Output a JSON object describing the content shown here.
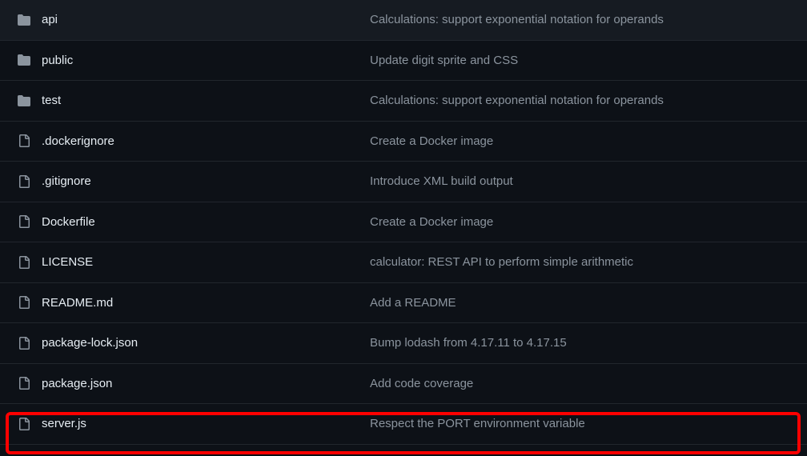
{
  "files": [
    {
      "type": "folder",
      "name": "api",
      "message": "Calculations: support exponential notation for operands"
    },
    {
      "type": "folder",
      "name": "public",
      "message": "Update digit sprite and CSS"
    },
    {
      "type": "folder",
      "name": "test",
      "message": "Calculations: support exponential notation for operands"
    },
    {
      "type": "file",
      "name": ".dockerignore",
      "message": "Create a Docker image"
    },
    {
      "type": "file",
      "name": ".gitignore",
      "message": "Introduce XML build output"
    },
    {
      "type": "file",
      "name": "Dockerfile",
      "message": "Create a Docker image"
    },
    {
      "type": "file",
      "name": "LICENSE",
      "message": "calculator: REST API to perform simple arithmetic"
    },
    {
      "type": "file",
      "name": "README.md",
      "message": "Add a README"
    },
    {
      "type": "file",
      "name": "package-lock.json",
      "message": "Bump lodash from 4.17.11 to 4.17.15"
    },
    {
      "type": "file",
      "name": "package.json",
      "message": "Add code coverage"
    },
    {
      "type": "file",
      "name": "server.js",
      "message": "Respect the PORT environment variable"
    }
  ],
  "icons": {
    "folder": "folder-icon",
    "file": "file-icon"
  }
}
